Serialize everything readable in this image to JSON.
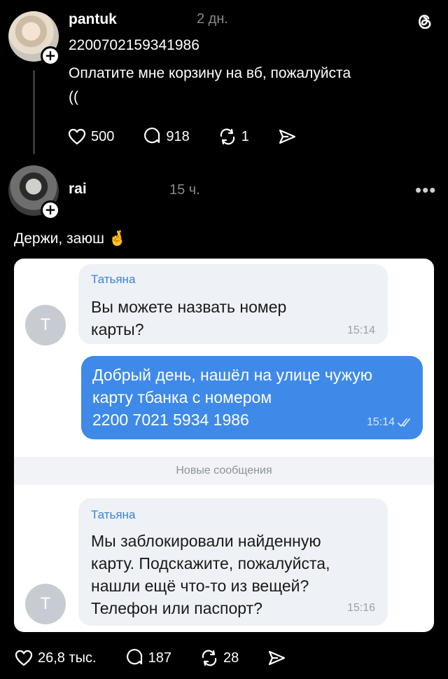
{
  "app": {
    "logo_icon": "threads-logo-icon"
  },
  "post": {
    "username": "pantuk",
    "time": "2 дн.",
    "line1": "2200702159341986",
    "line2": "Оплатите мне корзину на вб, пожалуйста",
    "line3": "((",
    "likes": "500",
    "comments": "918",
    "reposts": "1"
  },
  "reply": {
    "username": "rai",
    "time": "15 ч.",
    "more_icon": "more-horizontal-icon",
    "text": "Держи, заюш",
    "emoji": "🤞",
    "likes": "26,8 тыс.",
    "comments": "187",
    "reposts": "28"
  },
  "chat": {
    "avatar_letter": "Т",
    "msg1": {
      "sender": "Татьяна",
      "line1": "Вы можете назвать номер",
      "line2": "карты?",
      "time": "15:14"
    },
    "msg2": {
      "line1": "Добрый день, нашёл на улице чужую",
      "line2": "карту тбанка с номером",
      "line3": "2200 7021 5934 1986",
      "time": "15:14"
    },
    "divider": "Новые сообщения",
    "msg3": {
      "sender": "Татьяна",
      "line1": "Мы заблокировали найденную",
      "line2": "карту. Подскажите, пожалуйста,",
      "line3": "нашли ещё что-то из вещей?",
      "line4": "Телефон или паспорт?",
      "time": "15:16"
    }
  },
  "colors": {
    "background": "#000000",
    "accent_blue": "#3f8ae8",
    "sender_blue": "#3a84d8"
  }
}
